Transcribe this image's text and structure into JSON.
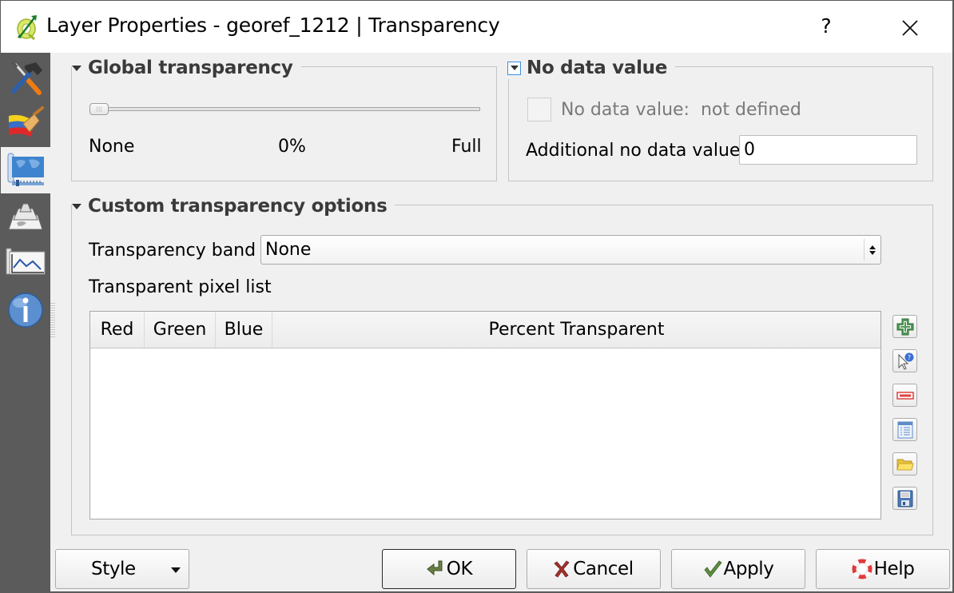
{
  "window": {
    "title": "Layer Properties - georef_1212 | Transparency",
    "help_label": "?",
    "app_icon": "qgis-logo-icon",
    "close_icon": "close-icon"
  },
  "sidebar": {
    "items": [
      {
        "name": "General",
        "icon": "tools-icon",
        "active": false
      },
      {
        "name": "Style",
        "icon": "paint-brush-icon",
        "active": false
      },
      {
        "name": "Transparency",
        "icon": "transparency-map-icon",
        "active": true
      },
      {
        "name": "Pyramids",
        "icon": "pyramid-icon",
        "active": false
      },
      {
        "name": "Histogram",
        "icon": "histogram-icon",
        "active": false
      },
      {
        "name": "Metadata",
        "icon": "info-icon",
        "active": false
      }
    ]
  },
  "global_transparency": {
    "title": "Global transparency",
    "slider_value_percent": 0,
    "min_label": "None",
    "value_label": "0%",
    "max_label": "Full"
  },
  "no_data": {
    "title": "No data value",
    "group_checked": true,
    "no_data_checkbox_label": "No data value:",
    "no_data_checkbox_value": "not defined",
    "no_data_checkbox_checked": false,
    "additional_label": "Additional no data value",
    "additional_value": "0"
  },
  "custom": {
    "title": "Custom transparency options",
    "band_label": "Transparency band",
    "band_value": "None",
    "pixel_list_label": "Transparent pixel list",
    "columns": [
      "Red",
      "Green",
      "Blue",
      "Percent Transparent"
    ],
    "rows": [],
    "tools": [
      {
        "name": "add-value-manually",
        "icon": "add-icon"
      },
      {
        "name": "add-value-from-display",
        "icon": "pointer-query-icon"
      },
      {
        "name": "remove-value",
        "icon": "remove-icon"
      },
      {
        "name": "default-values",
        "icon": "table-defaults-icon"
      },
      {
        "name": "import-from-file",
        "icon": "folder-open-icon"
      },
      {
        "name": "export-to-file",
        "icon": "save-icon"
      }
    ]
  },
  "footer": {
    "style_label": "Style",
    "ok_label": "OK",
    "cancel_label": "Cancel",
    "apply_label": "Apply",
    "help_label": "Help"
  }
}
